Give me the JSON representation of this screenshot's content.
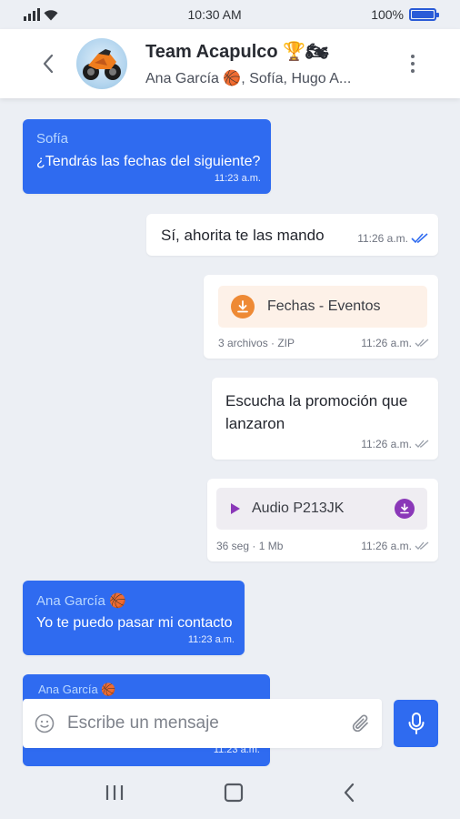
{
  "status": {
    "time": "10:30 AM",
    "battery": "100%"
  },
  "header": {
    "title": "Team Acapulco 🏆🏍",
    "members": "Ana García 🏀, Sofía, Hugo A..."
  },
  "messages": {
    "m1": {
      "sender": "Sofía",
      "text": "¿Tendrás las fechas del siguiente?",
      "time": "11:23 a.m."
    },
    "m2": {
      "text": "Sí, ahorita te las mando",
      "time": "11:26 a.m."
    },
    "m3": {
      "file_name": "Fechas - Eventos",
      "info": "3 archivos · ZIP",
      "time": "11:26 a.m."
    },
    "m4": {
      "text": "Escucha la promoción que lanzaron",
      "time": "11:26 a.m."
    },
    "m5": {
      "audio_name": "Audio P213JK",
      "info": "36 seg · 1 Mb",
      "time": "11:26 a.m."
    },
    "m6": {
      "sender": "Ana García 🏀",
      "text": "Yo te puedo pasar mi contacto",
      "time": "11:23 a.m."
    },
    "m7": {
      "sender": "Ana García 🏀",
      "time": "11:23 a.m."
    }
  },
  "composer": {
    "placeholder": "Escribe un mensaje"
  },
  "icons": {
    "back": "chevron-left-icon",
    "menu": "kebab-menu-icon",
    "download": "download-icon",
    "play": "play-icon",
    "emoji": "smiley-icon",
    "attach": "paperclip-icon",
    "mic": "microphone-icon",
    "read": "double-check-icon"
  },
  "colors": {
    "accent": "#2f6bf0",
    "file_card": "#fdf1e8",
    "file_icon": "#ee8a35",
    "audio_card": "#efedf2",
    "audio_icon": "#8a38b8"
  }
}
